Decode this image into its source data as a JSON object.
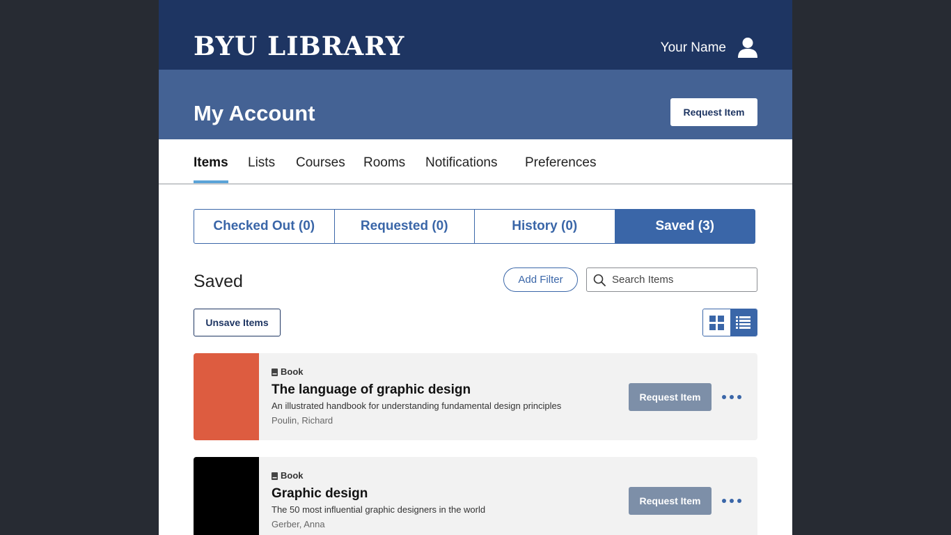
{
  "header": {
    "brand": "BYU LIBRARY",
    "user_name": "Your Name",
    "user_icon": "user-icon"
  },
  "account": {
    "title": "My Account",
    "request_label": "Request Item"
  },
  "nav": {
    "tabs": [
      {
        "label": "Items",
        "active": true
      },
      {
        "label": "Lists",
        "active": false
      },
      {
        "label": "Courses",
        "active": false
      },
      {
        "label": "Rooms",
        "active": false
      },
      {
        "label": "Notifications",
        "active": false
      },
      {
        "label": "Preferences",
        "active": false
      }
    ]
  },
  "segments": [
    {
      "label": "Checked Out (0)",
      "active": false
    },
    {
      "label": "Requested (0)",
      "active": false
    },
    {
      "label": "History (0)",
      "active": false
    },
    {
      "label": "Saved (3)",
      "active": true
    }
  ],
  "section": {
    "title": "Saved",
    "filter_label": "Add Filter",
    "search_placeholder": "Search Items",
    "unsave_label": "Unsave Items",
    "view_mode": "list"
  },
  "items": [
    {
      "type": "Book",
      "title": "The language of graphic design",
      "subtitle": "An illustrated handbook for understanding fundamental design principles",
      "author": "Poulin, Richard",
      "cover_color": "#dd5c40",
      "request_label": "Request Item"
    },
    {
      "type": "Book",
      "title": "Graphic design",
      "subtitle": "The 50 most influential graphic designers in the world",
      "author": "Gerber, Anna",
      "cover_color": "#000000",
      "request_label": "Request Item"
    }
  ],
  "colors": {
    "topbar": "#1e3562",
    "account_bar": "#446294",
    "accent": "#3a66a8",
    "tab_underline": "#5ba3d8",
    "disabled_button": "#7d8fa8"
  }
}
